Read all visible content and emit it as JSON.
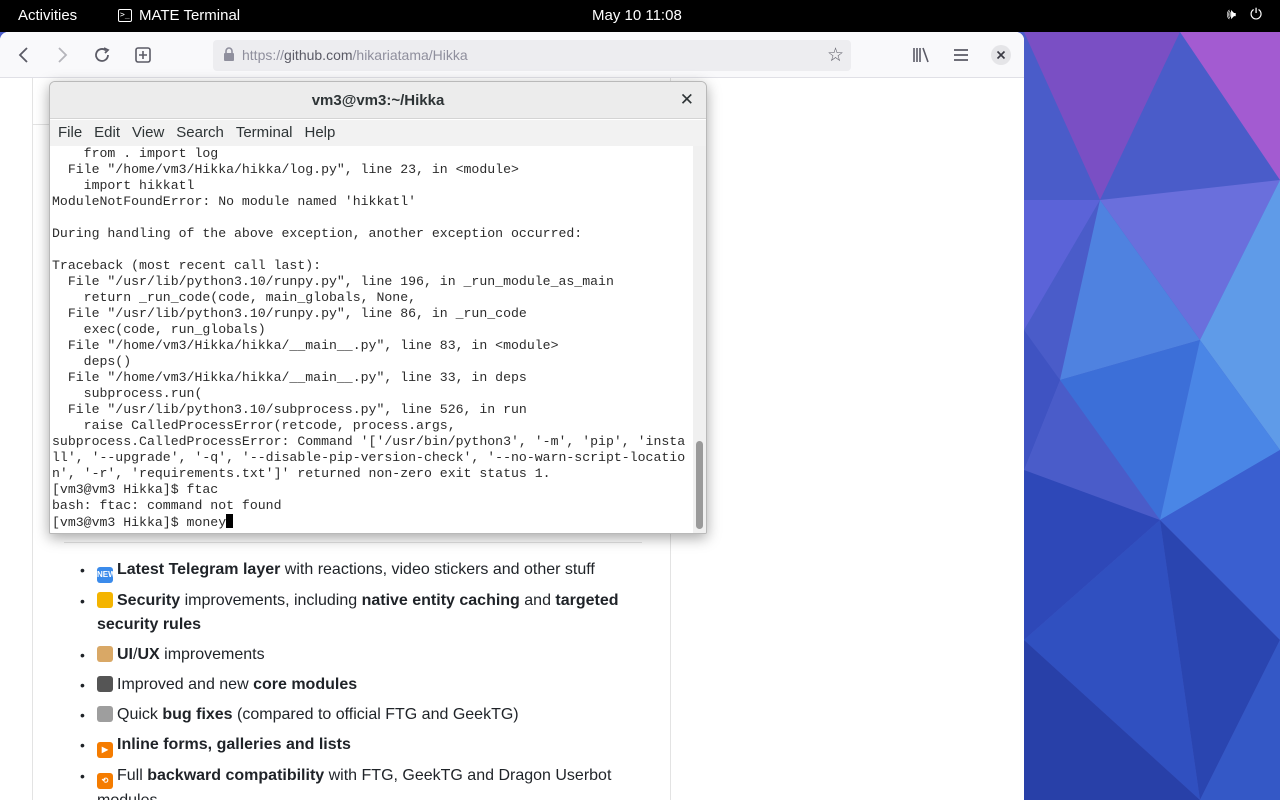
{
  "topbar": {
    "activities": "Activities",
    "app_name": "MATE Terminal",
    "clock": "May 10  11:08",
    "volume_icon": "🕪",
    "power_icon": "⏻"
  },
  "browser": {
    "url_scheme": "https://",
    "url_host": "github.com",
    "url_path": "/hikariatama/Hikka"
  },
  "terminal": {
    "title": "vm3@vm3:~/Hikka",
    "menu": [
      "File",
      "Edit",
      "View",
      "Search",
      "Terminal",
      "Help"
    ],
    "lines": [
      "    from . import log",
      "  File \"/home/vm3/Hikka/hikka/log.py\", line 23, in <module>",
      "    import hikkatl",
      "ModuleNotFoundError: No module named 'hikkatl'",
      "",
      "During handling of the above exception, another exception occurred:",
      "",
      "Traceback (most recent call last):",
      "  File \"/usr/lib/python3.10/runpy.py\", line 196, in _run_module_as_main",
      "    return _run_code(code, main_globals, None,",
      "  File \"/usr/lib/python3.10/runpy.py\", line 86, in _run_code",
      "    exec(code, run_globals)",
      "  File \"/home/vm3/Hikka/hikka/__main__.py\", line 83, in <module>",
      "    deps()",
      "  File \"/home/vm3/Hikka/hikka/__main__.py\", line 33, in deps",
      "    subprocess.run(",
      "  File \"/usr/lib/python3.10/subprocess.py\", line 526, in run",
      "    raise CalledProcessError(retcode, process.args,",
      "subprocess.CalledProcessError: Command '['/usr/bin/python3', '-m', 'pip', 'insta",
      "ll', '--upgrade', '-q', '--disable-pip-version-check', '--no-warn-script-locatio",
      "n', '-r', 'requirements.txt']' returned non-zero exit status 1.",
      "[vm3@vm3 Hikka]$ ftac",
      "bash: ftac: command not found"
    ],
    "prompt": "[vm3@vm3 Hikka]$ ",
    "input": "money"
  },
  "features": [
    {
      "icon": "new-icon",
      "color": "#3b8beb",
      "icon_text": "NEW",
      "parts": [
        {
          "t": "Latest Telegram layer",
          "b": true
        },
        {
          "t": " with reactions, video stickers and other stuff",
          "b": false
        }
      ]
    },
    {
      "icon": "lock-icon",
      "color": "#f4b400",
      "icon_text": "",
      "parts": [
        {
          "t": "Security",
          "b": true
        },
        {
          "t": " improvements, including ",
          "b": false
        },
        {
          "t": "native entity caching",
          "b": true
        },
        {
          "t": " and ",
          "b": false
        },
        {
          "t": "targeted security rules",
          "b": true
        }
      ]
    },
    {
      "icon": "palette-icon",
      "color": "#d9a866",
      "icon_text": "",
      "parts": [
        {
          "t": "UI",
          "b": true
        },
        {
          "t": "/",
          "b": false
        },
        {
          "t": "UX",
          "b": true
        },
        {
          "t": " improvements",
          "b": false
        }
      ]
    },
    {
      "icon": "cassette-icon",
      "color": "#555555",
      "icon_text": "",
      "parts": [
        {
          "t": "Improved and new ",
          "b": false
        },
        {
          "t": "core modules",
          "b": true
        }
      ]
    },
    {
      "icon": "stopwatch-icon",
      "color": "#9e9e9e",
      "icon_text": "",
      "parts": [
        {
          "t": "Quick ",
          "b": false
        },
        {
          "t": "bug fixes",
          "b": true
        },
        {
          "t": " (compared to official FTG and GeekTG)",
          "b": false
        }
      ]
    },
    {
      "icon": "play-button-icon",
      "color": "#f57c00",
      "icon_text": "▶",
      "parts": [
        {
          "t": "Inline forms, galleries and lists",
          "b": true
        }
      ]
    },
    {
      "icon": "repeat-icon",
      "color": "#f57c00",
      "icon_text": "⟲",
      "parts": [
        {
          "t": "Full ",
          "b": false
        },
        {
          "t": "backward compatibility",
          "b": true
        },
        {
          "t": " with FTG, GeekTG and Dragon Userbot modules",
          "b": false
        }
      ]
    }
  ]
}
